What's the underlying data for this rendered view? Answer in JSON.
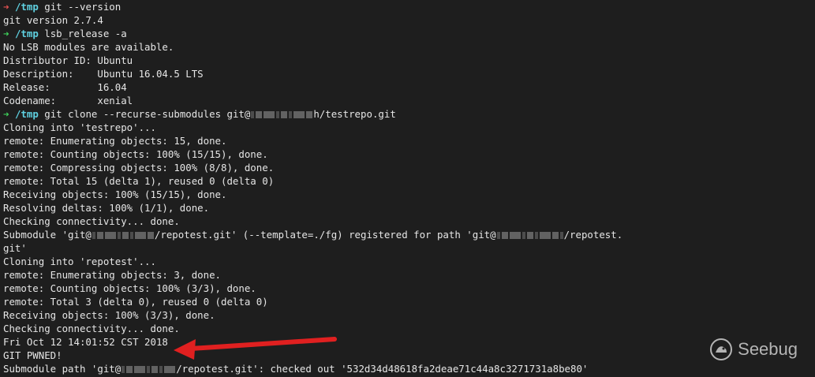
{
  "terminal": {
    "lines": [
      {
        "type": "prompt",
        "arrow": "➜",
        "arrow_color": "#e05050",
        "cwd": "/tmp",
        "cmd": "git --version"
      },
      {
        "type": "out",
        "text": "git version 2.7.4"
      },
      {
        "type": "prompt",
        "arrow": "➜",
        "arrow_color": "#3ecf5a",
        "cwd": "/tmp",
        "cmd": "lsb_release -a"
      },
      {
        "type": "out",
        "text": "No LSB modules are available."
      },
      {
        "type": "out",
        "text": "Distributor ID:\tUbuntu"
      },
      {
        "type": "out",
        "text": "Description:\tUbuntu 16.04.5 LTS"
      },
      {
        "type": "out",
        "text": "Release:\t16.04"
      },
      {
        "type": "out",
        "text": "Codename:\txenial"
      },
      {
        "type": "prompt_redacted",
        "arrow": "➜",
        "arrow_color": "#3ecf5a",
        "cwd": "/tmp",
        "cmd_before": "git clone --recurse-submodules git@",
        "cmd_after": "h/testrepo.git"
      },
      {
        "type": "out",
        "text": "Cloning into 'testrepo'..."
      },
      {
        "type": "out",
        "text": "remote: Enumerating objects: 15, done."
      },
      {
        "type": "out",
        "text": "remote: Counting objects: 100% (15/15), done."
      },
      {
        "type": "out",
        "text": "remote: Compressing objects: 100% (8/8), done."
      },
      {
        "type": "out",
        "text": "remote: Total 15 (delta 1), reused 0 (delta 0)"
      },
      {
        "type": "out",
        "text": "Receiving objects: 100% (15/15), done."
      },
      {
        "type": "out",
        "text": "Resolving deltas: 100% (1/1), done."
      },
      {
        "type": "out",
        "text": "Checking connectivity... done."
      },
      {
        "type": "out_redacted",
        "before": "Submodule 'git@",
        "middle": "/repotest.git' (--template=./fg) registered for path 'git@",
        "after": "/repotest."
      },
      {
        "type": "out",
        "text": "git'"
      },
      {
        "type": "out",
        "text": "Cloning into 'repotest'..."
      },
      {
        "type": "out",
        "text": "remote: Enumerating objects: 3, done."
      },
      {
        "type": "out",
        "text": "remote: Counting objects: 100% (3/3), done."
      },
      {
        "type": "out",
        "text": "remote: Total 3 (delta 0), reused 0 (delta 0)"
      },
      {
        "type": "out",
        "text": "Receiving objects: 100% (3/3), done."
      },
      {
        "type": "out",
        "text": "Checking connectivity... done."
      },
      {
        "type": "out",
        "text": "Fri Oct 12 14:01:52 CST 2018"
      },
      {
        "type": "out",
        "text": "GIT PWNED!"
      },
      {
        "type": "out_redacted_end",
        "before": "Submodule path 'git@",
        "after": "/repotest.git': checked out '532d34d48618fa2deae71c44a8c3271731a8be80'"
      }
    ]
  },
  "annotation": {
    "color": "#e02020"
  },
  "watermark": {
    "text": "Seebug",
    "icon": "seebug-logo-icon"
  }
}
